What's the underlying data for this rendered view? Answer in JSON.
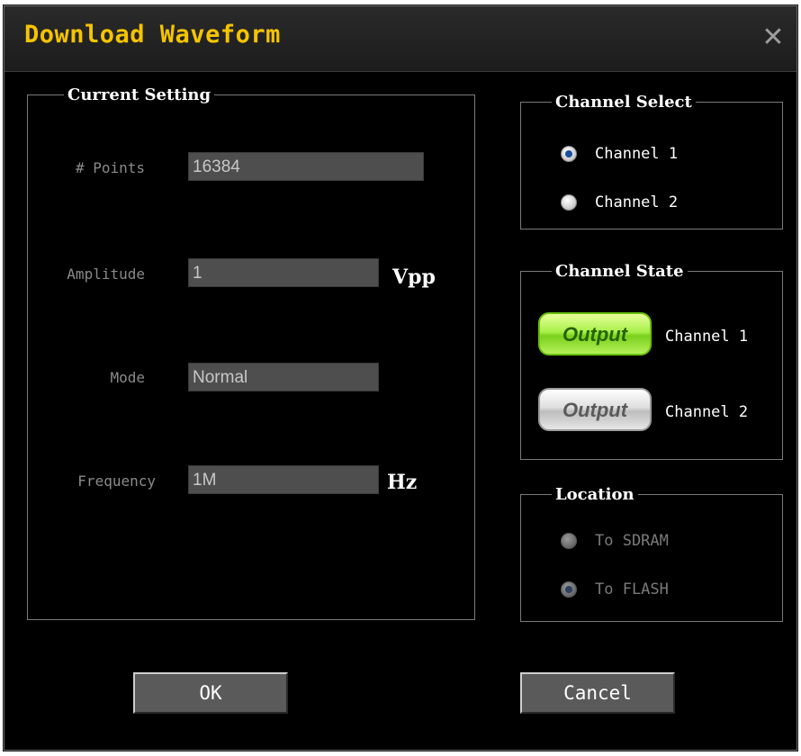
{
  "dialog": {
    "title": "Download Waveform",
    "close_glyph": "✕"
  },
  "current_setting": {
    "legend": "Current Setting",
    "points": {
      "label": "# Points",
      "value": "16384"
    },
    "amplitude": {
      "label": "Amplitude",
      "value": "1",
      "unit": "Vpp"
    },
    "mode": {
      "label": "Mode",
      "value": "Normal"
    },
    "frequency": {
      "label": "Frequency",
      "value": "1M",
      "unit": "Hz"
    }
  },
  "channel_select": {
    "legend": "Channel Select",
    "options": [
      {
        "label": "Channel 1",
        "selected": true
      },
      {
        "label": "Channel 2",
        "selected": false
      }
    ]
  },
  "channel_state": {
    "legend": "Channel State",
    "items": [
      {
        "button": "Output",
        "label": "Channel 1",
        "state": "on",
        "color": "#8ee830"
      },
      {
        "button": "Output",
        "label": "Channel 2",
        "state": "off",
        "color": "#d0d0d0"
      }
    ]
  },
  "location": {
    "legend": "Location",
    "options": [
      {
        "label": "To SDRAM",
        "selected": false
      },
      {
        "label": "To FLASH",
        "selected": true
      }
    ]
  },
  "buttons": {
    "ok": "OK",
    "cancel": "Cancel"
  },
  "colors": {
    "title": "#f5c400",
    "background": "#000000",
    "field": "#4e4e4e"
  }
}
